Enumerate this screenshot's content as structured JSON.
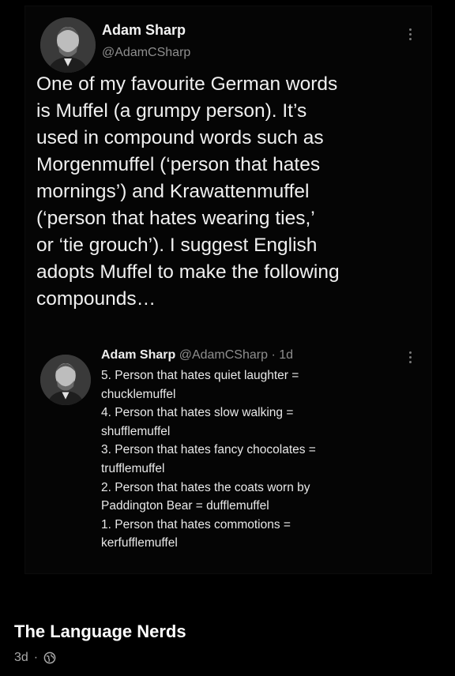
{
  "tweet": {
    "author_name": "Adam Sharp",
    "author_handle": "@AdamCSharp",
    "text": "One of my favourite German words\nis Muffel (a grumpy person). It’s\nused in compound words such as\nMorgenmuffel (‘person that hates\nmornings’) and Krawattenmuffel\n(‘person that hates wearing ties,’\nor ‘tie grouch’). I suggest English\nadopts Muffel to make the following\ncompounds…",
    "avatar_icon": "profile-photo"
  },
  "quoted_reply": {
    "author_name": "Adam Sharp",
    "meta": "@AdamCSharp · 1d",
    "text": "5. Person that hates quiet laughter =\nchucklemuffel\n4. Person that hates slow walking =\nshufflemuffel\n3. Person that hates fancy chocolates =\ntrufflemuffel\n2. Person that hates the coats worn by\nPaddington Bear = dufflemuffel\n1. Person that hates commotions =\nkerfufflemuffel",
    "avatar_icon": "profile-photo"
  },
  "post": {
    "page_name": "The Language Nerds",
    "age": "3d",
    "separator": "·",
    "audience_icon": "globe-icon"
  },
  "colors": {
    "background": "#000000",
    "text_primary": "#f0f0f0",
    "text_secondary": "#8e8e8e"
  }
}
